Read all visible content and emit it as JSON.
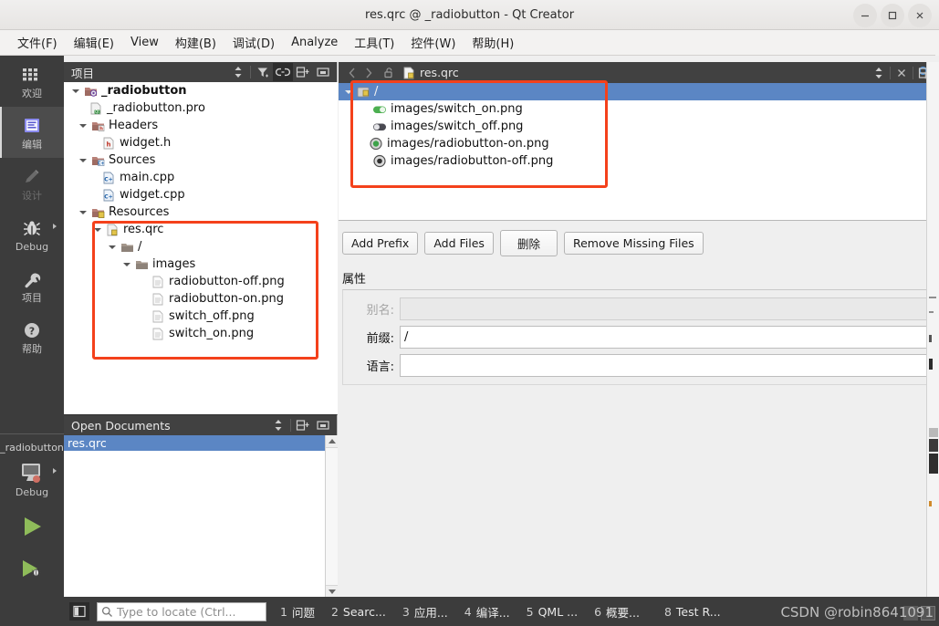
{
  "window": {
    "title": "res.qrc @ _radiobutton - Qt Creator",
    "minimize_label": "minimize-icon",
    "maximize_label": "maximize-icon",
    "close_label": "close-icon"
  },
  "menubar": {
    "items": [
      {
        "label": "文件(F)",
        "mnemonic": "F"
      },
      {
        "label": "编辑(E)",
        "mnemonic": "E"
      },
      {
        "label": "View",
        "mnemonic": "V"
      },
      {
        "label": "构建(B)",
        "mnemonic": "B"
      },
      {
        "label": "调试(D)",
        "mnemonic": "D"
      },
      {
        "label": "Analyze",
        "mnemonic": "A"
      },
      {
        "label": "工具(T)",
        "mnemonic": "T"
      },
      {
        "label": "控件(W)",
        "mnemonic": "W"
      },
      {
        "label": "帮助(H)",
        "mnemonic": "H"
      }
    ]
  },
  "modebar": {
    "items": [
      {
        "label": "欢迎",
        "icon": "grid-icon",
        "active": false,
        "dim": false,
        "arrow": false
      },
      {
        "label": "编辑",
        "icon": "edit-icon",
        "active": true,
        "dim": false,
        "arrow": false
      },
      {
        "label": "设计",
        "icon": "pencil-icon",
        "active": false,
        "dim": true,
        "arrow": false
      },
      {
        "label": "Debug",
        "icon": "bug-icon",
        "active": false,
        "dim": false,
        "arrow": true
      },
      {
        "label": "项目",
        "icon": "wrench-icon",
        "active": false,
        "dim": false,
        "arrow": false
      },
      {
        "label": "帮助",
        "icon": "question-icon",
        "active": false,
        "dim": false,
        "arrow": false
      }
    ],
    "kit": {
      "project_name": "_radiobutton",
      "build_config": "Debug",
      "icon": "desktop-icon",
      "arrow": true
    },
    "actions": [
      {
        "name": "run-button",
        "icon": "play-icon"
      },
      {
        "name": "debug-button",
        "icon": "play-bug-icon"
      },
      {
        "name": "build-button",
        "icon": "hammer-icon"
      }
    ]
  },
  "project_panel": {
    "title": "项目",
    "toolbar": [
      {
        "name": "sync-selection-icon",
        "glyph": "updown"
      },
      {
        "name": "filter-icon",
        "glyph": "filter"
      },
      {
        "name": "link-with-editor-icon",
        "glyph": "link",
        "pressed": true
      },
      {
        "name": "split-icon",
        "glyph": "split"
      },
      {
        "name": "close-panel-icon",
        "glyph": "closebox"
      }
    ],
    "tree": [
      {
        "label": "_radiobutton",
        "depth": 0,
        "icon": "project-folder-icon",
        "arrow": "down",
        "bold": true
      },
      {
        "label": "_radiobutton.pro",
        "depth": 1,
        "icon": "pro-file-icon",
        "arrow": "none",
        "bold": false
      },
      {
        "label": "Headers",
        "depth": 1,
        "icon": "headers-folder-icon",
        "arrow": "down",
        "bold": false
      },
      {
        "label": "widget.h",
        "depth": 2,
        "icon": "h-file-icon",
        "arrow": "none",
        "bold": false
      },
      {
        "label": "Sources",
        "depth": 1,
        "icon": "sources-folder-icon",
        "arrow": "down",
        "bold": false
      },
      {
        "label": "main.cpp",
        "depth": 2,
        "icon": "cpp-file-icon",
        "arrow": "none",
        "bold": false
      },
      {
        "label": "widget.cpp",
        "depth": 2,
        "icon": "cpp-file-icon",
        "arrow": "none",
        "bold": false
      },
      {
        "label": "Resources",
        "depth": 1,
        "icon": "resources-folder-icon",
        "arrow": "down",
        "bold": false
      },
      {
        "label": "res.qrc",
        "depth": 2,
        "icon": "qrc-file-icon",
        "arrow": "down",
        "bold": false
      },
      {
        "label": "/",
        "depth": 3,
        "icon": "folder-icon",
        "arrow": "down",
        "bold": false
      },
      {
        "label": "images",
        "depth": 4,
        "icon": "folder-icon",
        "arrow": "down",
        "bold": false
      },
      {
        "label": "radiobutton-off.png",
        "depth": 5,
        "icon": "file-icon",
        "arrow": "none",
        "bold": false
      },
      {
        "label": "radiobutton-on.png",
        "depth": 5,
        "icon": "file-icon",
        "arrow": "none",
        "bold": false
      },
      {
        "label": "switch_off.png",
        "depth": 5,
        "icon": "file-icon",
        "arrow": "none",
        "bold": false
      },
      {
        "label": "switch_on.png",
        "depth": 5,
        "icon": "file-icon",
        "arrow": "none",
        "bold": false
      }
    ]
  },
  "open_documents": {
    "title": "Open Documents",
    "toolbar": [
      {
        "name": "sync-selection-icon",
        "glyph": "updown"
      },
      {
        "name": "split-icon",
        "glyph": "split"
      },
      {
        "name": "close-panel-icon",
        "glyph": "closebox"
      }
    ],
    "items": [
      {
        "label": "res.qrc",
        "selected": true
      }
    ]
  },
  "editor": {
    "toolbar": {
      "back_icon": "back-arrow-icon",
      "forward_icon": "forward-arrow-icon",
      "lock_icon": "unlocked-icon",
      "file_icon": "qrc-file-icon",
      "file_name": "res.qrc",
      "select_icon": "updown-icon",
      "close_icon": "close-icon",
      "extra_icon": "open-in-editor-icon",
      "split_icon": "split-icon"
    },
    "resource_tree": [
      {
        "label": "/",
        "icon": "qrc-prefix-icon",
        "depth": 0,
        "selected": true,
        "arrow": "down"
      },
      {
        "label": "images/switch_on.png",
        "icon": "switch-on-icon",
        "depth": 1,
        "selected": false,
        "arrow": "none"
      },
      {
        "label": "images/switch_off.png",
        "icon": "switch-off-icon",
        "depth": 1,
        "selected": false,
        "arrow": "none"
      },
      {
        "label": "images/radiobutton-on.png",
        "icon": "radiobutton-on-icon",
        "depth": 1,
        "selected": false,
        "arrow": "none"
      },
      {
        "label": "images/radiobutton-off.png",
        "icon": "radiobutton-off-icon",
        "depth": 1,
        "selected": false,
        "arrow": "none"
      }
    ],
    "buttons": [
      {
        "label": "Add Prefix",
        "name": "add-prefix-button",
        "wide": false
      },
      {
        "label": "Add Files",
        "name": "add-files-button",
        "wide": false
      },
      {
        "label": "删除",
        "name": "delete-button",
        "wide": true
      },
      {
        "label": "Remove Missing Files",
        "name": "remove-missing-files-button",
        "wide": false
      }
    ],
    "properties": {
      "title": "属性",
      "fields": [
        {
          "label": "别名:",
          "value": "",
          "name": "alias-field",
          "disabled": true
        },
        {
          "label": "前缀:",
          "value": "/",
          "name": "prefix-field",
          "disabled": false
        },
        {
          "label": "语言:",
          "value": "",
          "name": "language-field",
          "disabled": false
        }
      ]
    }
  },
  "statusbar": {
    "toggle_sidebar_icon": "toggle-sidebar-icon",
    "locator": {
      "placeholder": "Type to locate (Ctrl...",
      "icon": "search-icon"
    },
    "panes": [
      {
        "number": "1",
        "label": "问题"
      },
      {
        "number": "2",
        "label": "Searc..."
      },
      {
        "number": "3",
        "label": "应用..."
      },
      {
        "number": "4",
        "label": "编译..."
      },
      {
        "number": "5",
        "label": "QML ..."
      },
      {
        "number": "6",
        "label": "概要..."
      },
      {
        "number": "8",
        "label": "Test R..."
      }
    ]
  },
  "watermark": {
    "text": "CSDN @robin8641091"
  },
  "annotations": {
    "boxes": [
      {
        "name": "resource-tree-highlight"
      },
      {
        "name": "project-resources-highlight"
      }
    ],
    "color": "#f4411b"
  }
}
